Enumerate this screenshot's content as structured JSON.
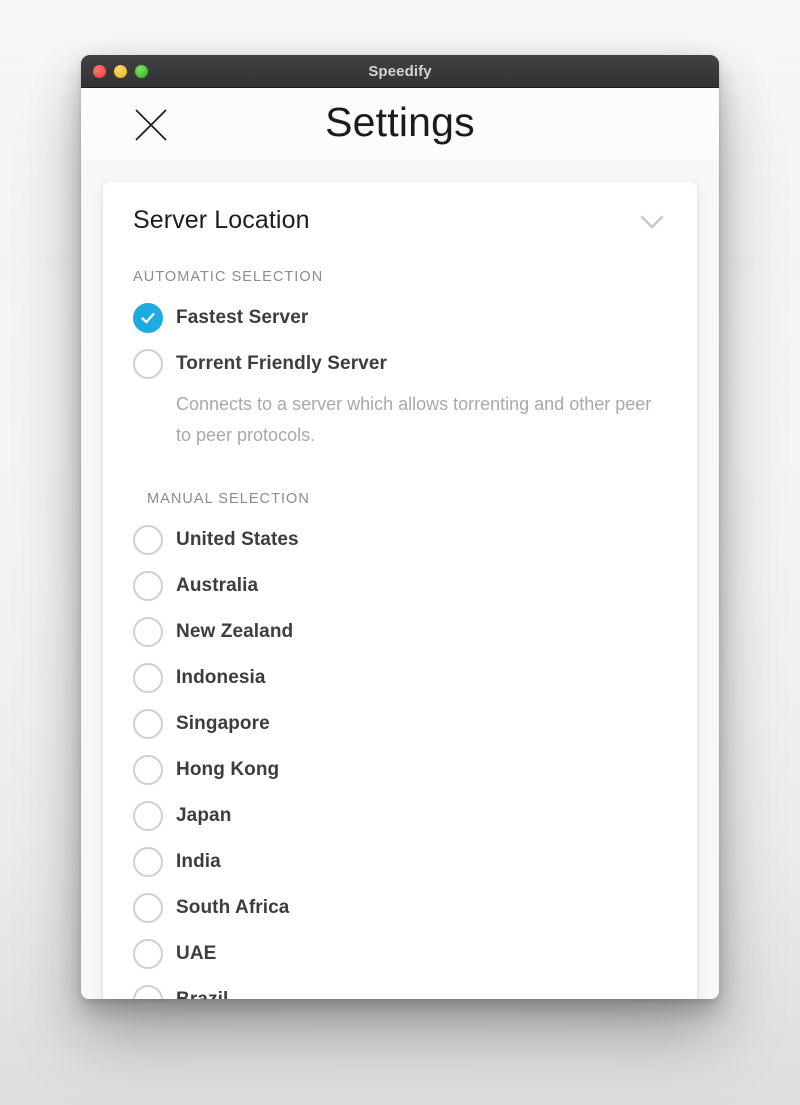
{
  "window": {
    "title": "Speedify",
    "traffic_lights": [
      {
        "name": "close",
        "color": "#f2564c"
      },
      {
        "name": "minimize",
        "color": "#f2c23c"
      },
      {
        "name": "zoom",
        "color": "#4fc434"
      }
    ]
  },
  "header": {
    "close_icon": "close-x-icon",
    "title": "Settings"
  },
  "card": {
    "heading": "Server Location",
    "collapse_icon": "chevron-down-icon",
    "sections": [
      {
        "label": "AUTOMATIC SELECTION",
        "options": [
          {
            "label": "Fastest Server",
            "selected": true,
            "description": null
          },
          {
            "label": "Torrent Friendly Server",
            "selected": false,
            "description": "Connects to a server which allows torrenting and other peer to peer protocols."
          }
        ]
      },
      {
        "label": "MANUAL SELECTION",
        "options": [
          {
            "label": "United States",
            "selected": false,
            "description": null
          },
          {
            "label": "Australia",
            "selected": false,
            "description": null
          },
          {
            "label": "New Zealand",
            "selected": false,
            "description": null
          },
          {
            "label": "Indonesia",
            "selected": false,
            "description": null
          },
          {
            "label": "Singapore",
            "selected": false,
            "description": null
          },
          {
            "label": "Hong Kong",
            "selected": false,
            "description": null
          },
          {
            "label": "Japan",
            "selected": false,
            "description": null
          },
          {
            "label": "India",
            "selected": false,
            "description": null
          },
          {
            "label": "South Africa",
            "selected": false,
            "description": null
          },
          {
            "label": "UAE",
            "selected": false,
            "description": null
          },
          {
            "label": "Brazil",
            "selected": false,
            "description": null
          }
        ]
      }
    ]
  },
  "colors": {
    "accent": "#1eabe2",
    "titlebar": "#3a3a3c",
    "label_text": "#3b3d40",
    "muted_text": "#8c8c8c",
    "description_text": "#a9a9a9",
    "radio_border": "#cfcfcf"
  }
}
